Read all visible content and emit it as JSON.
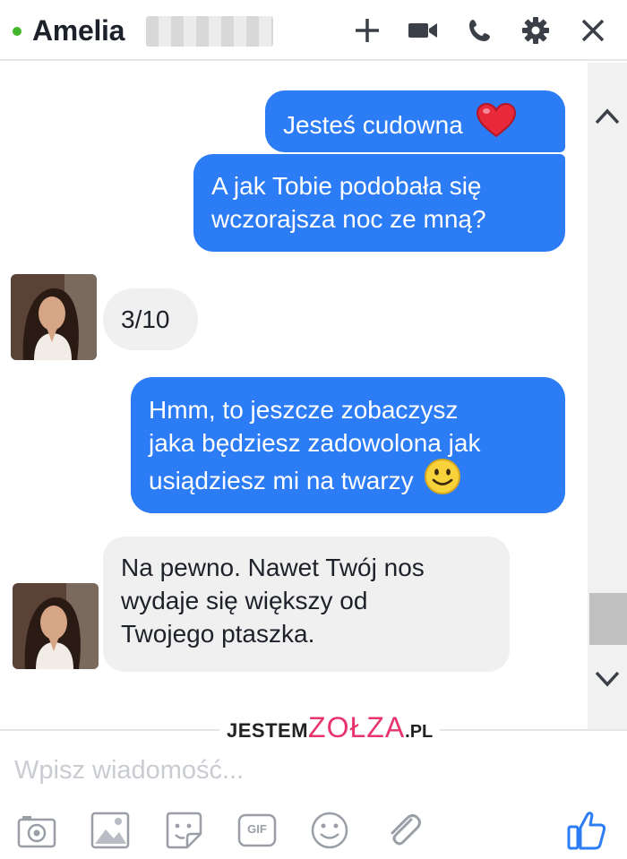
{
  "header": {
    "contact_name": "Amelia",
    "status": "online",
    "icons": [
      "plus-icon",
      "video-camera-icon",
      "phone-icon",
      "gear-icon",
      "close-icon"
    ]
  },
  "messages": [
    {
      "direction": "outgoing",
      "text": "Jesteś cudowna",
      "emoji": "red-heart-emoji"
    },
    {
      "direction": "outgoing",
      "lines": [
        "A jak Tobie podobała się",
        "wczorajsza noc ze mną?"
      ]
    },
    {
      "direction": "incoming",
      "text": "3/10"
    },
    {
      "direction": "outgoing",
      "lines": [
        "Hmm, to jeszcze zobaczysz",
        "jaka będziesz zadowolona jak",
        "usiądziesz mi na twarzy"
      ],
      "emoji": "smiling-face-emoji"
    },
    {
      "direction": "incoming",
      "lines": [
        "Na pewno. Nawet Twój nos",
        "wydaje się większy od",
        "Twojego ptaszka."
      ]
    }
  ],
  "watermark": {
    "part1": "JESTEM",
    "part2": "ZOŁZA",
    "part3": ".PL"
  },
  "composer": {
    "placeholder": "Wpisz wiadomość...",
    "tools": [
      "camera-icon",
      "image-icon",
      "sticker-icon",
      "gif-icon",
      "emoji-icon",
      "paperclip-icon",
      "thumbs-up-icon"
    ],
    "gif_label": "GIF"
  },
  "colors": {
    "outgoing_bubble": "#2c7cf6",
    "incoming_bubble": "#f1f0f0",
    "online": "#42b72a",
    "like": "#2c7cf6"
  }
}
